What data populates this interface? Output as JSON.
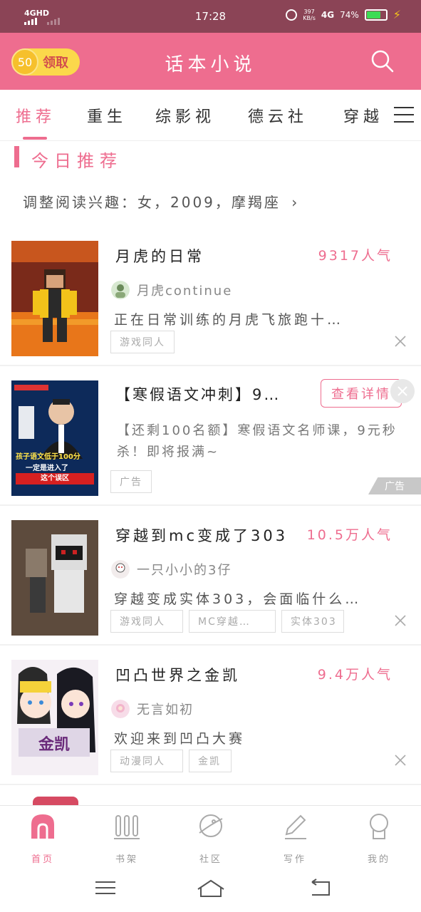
{
  "status_bar": {
    "network": "4GHD",
    "time": "17:28",
    "speed_value": "397",
    "speed_unit": "KB/s",
    "network2": "4G",
    "battery": "74%",
    "battery_level": 0.74,
    "battery_color": "#3ddc54"
  },
  "header": {
    "coin_amount": "50",
    "claim_label": "领取",
    "title": "话本小说",
    "accent_color": "#ee6d8f"
  },
  "tabs": [
    {
      "label": "推荐",
      "active": true
    },
    {
      "label": "重生",
      "active": false
    },
    {
      "label": "综影视",
      "active": false
    },
    {
      "label": "德云社",
      "active": false
    },
    {
      "label": "穿越",
      "active": false
    }
  ],
  "section": {
    "title": "今日推荐",
    "interest_text": "调整阅读兴趣：女，2009，摩羯座"
  },
  "books": [
    {
      "title": "月虎的日常",
      "popularity": "9317人气",
      "author": "月虎continue",
      "description": "正在日常训练的月虎飞旅跑十…",
      "tags": [
        "游戏同人"
      ]
    },
    {
      "title": "穿越到mc变成了303",
      "popularity": "10.5万人气",
      "author": "一只小小的3仔",
      "description": "穿越变成实体303，会面临什么…",
      "tags": [
        "游戏同人",
        "MC穿越…",
        "实体303"
      ]
    },
    {
      "title": "凹凸世界之金凯",
      "popularity": "9.4万人气",
      "author": "无言如初",
      "description": "欢迎来到凹凸大赛",
      "tags": [
        "动漫同人",
        "金凯"
      ]
    }
  ],
  "ad": {
    "title": "【寒假语文冲刺】9…",
    "button": "查看详情",
    "description": "【还剩100名额】寒假语文名师课，9元秒杀！即将报满~",
    "tag": "广告",
    "badge": "广告",
    "cover_line1": "孩子语文低于100分",
    "cover_line2": "一定是进入了",
    "cover_line3": "这个误区"
  },
  "bottom_nav": [
    {
      "label": "首页",
      "icon": "home-icon",
      "active": true
    },
    {
      "label": "书架",
      "icon": "bookshelf-icon",
      "active": false
    },
    {
      "label": "社区",
      "icon": "planet-icon",
      "active": false
    },
    {
      "label": "写作",
      "icon": "pencil-icon",
      "active": false
    },
    {
      "label": "我的",
      "icon": "profile-icon",
      "active": false
    }
  ]
}
